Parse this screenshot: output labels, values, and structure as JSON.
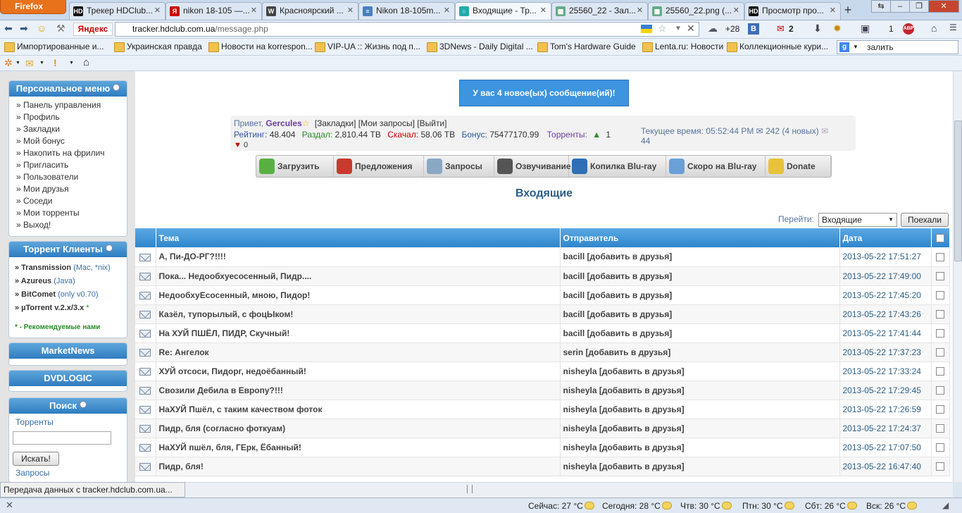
{
  "browser": {
    "menu_label": "Firefox",
    "tabs": [
      {
        "title": "Трекер HDClub...",
        "icon": "hd-icon"
      },
      {
        "title": "nikon 18-105 —...",
        "icon": "yandex-icon"
      },
      {
        "title": "Красноярский ...",
        "icon": "wikipedia-icon"
      },
      {
        "title": "Nikon 18-105m...",
        "icon": "page-icon"
      },
      {
        "title": "Входящие - Тр...",
        "icon": "loading-icon"
      },
      {
        "title": "25560_22 - Зал...",
        "icon": "image-icon"
      },
      {
        "title": "25560_22.png (...",
        "icon": "image-icon"
      },
      {
        "title": "Просмотр про...",
        "icon": "hd-icon"
      }
    ],
    "active_tab": 4,
    "new_tab_label": "+",
    "yandex_label": "Яндекс",
    "url_host": "tracker.hdclub.com.ua",
    "url_path": "/message.php",
    "weather_badge": "+28",
    "mail_count": "2",
    "counter_1": "1",
    "bookmarks": [
      "Импортированные и...",
      "Украинская правда",
      "Новости на korrespon...",
      "VIP-UA :: Жизнь под п...",
      "3DNews - Daily Digital ...",
      "Tom's Hardware Guide",
      "Lenta.ru: Новости",
      "Коллекционные кури..."
    ],
    "search_value": "залить",
    "status_text": "Передача данных с tracker.hdclub.com.ua...",
    "weather": [
      "Сейчас: 27 °C",
      "Сегодня: 28 °C",
      "Чтв: 30 °C",
      "Птн: 30 °C",
      "Сбт: 26 °C",
      "Вск: 26 °C"
    ]
  },
  "sidebar": {
    "personal_title": "Персональное меню",
    "personal_items": [
      "» Панель управления",
      "» Профиль",
      "» Закладки",
      "» Мой бонус",
      "» Накопить на фрилич",
      "» Пригласить",
      "» Пользователи",
      "» Мои друзья",
      "» Соседи",
      "» Мои торренты",
      "» Выход!"
    ],
    "clients_title": "Торрент Клиенты",
    "clients": [
      {
        "name": "» Transmission",
        "note": " (Mac, *nix)"
      },
      {
        "name": "» Azureus",
        "note": " (Java)"
      },
      {
        "name": "» BitComet",
        "note": " (only v0.70)"
      },
      {
        "name": "» µTorrent v.2.x/3.x",
        "note": " *"
      }
    ],
    "recommended_star": "*",
    "recommended_text": " - Рекомендуемые нами",
    "marketnews_title": "MarketNews",
    "dvdlogic_title": "DVDLOGIC",
    "search_title": "Поиск",
    "search_link": "Торренты",
    "search_button": "Искать!",
    "requests_link": "Запросы"
  },
  "main": {
    "new_messages": "У вас 4 новое(ых) сообщение(ий)!",
    "greeting": "Привет, ",
    "username": "Gercules",
    "user_links": "[Закладки] [Мои запросы] [Выйти]",
    "rating_label": "Рейтинг: ",
    "rating": "48.404",
    "upload_label": "Раздал: ",
    "upload": "2,810.44 TB",
    "download_label": "Скачал: ",
    "download": "58.06 TB",
    "bonus_label": "Бонус: ",
    "bonus": "75477170.99",
    "torrents_label": "Торренты: ",
    "seeding": "1",
    "leeching": "0",
    "time_label": "Текущее время: ",
    "time": "05:52:44 PM",
    "inbox_count": "242 (4 новых)",
    "outbox_count": "44",
    "actions": [
      {
        "label": "Загрузить",
        "color": "#58b043"
      },
      {
        "label": "Предложения",
        "color": "#c83a2e"
      },
      {
        "label": "Запросы",
        "color": "#8aa7c4"
      },
      {
        "label": "Озвучивание",
        "color": "#555555"
      },
      {
        "label": "Копилка Blu-ray",
        "color": "#2e6fb5"
      },
      {
        "label": "Скоро на Blu-ray",
        "color": "#6aa0d8"
      },
      {
        "label": "Donate",
        "color": "#e8c23a"
      }
    ],
    "page_title": "Входящие",
    "goto_label": "Перейти:",
    "goto_value": "Входящие",
    "goto_button": "Поехали",
    "columns": [
      "Тема",
      "Отправитель",
      "Дата"
    ],
    "messages": [
      {
        "subject": "А, Пи-ДО-РГ?!!!!",
        "sender": "bacill [добавить в друзья]",
        "date": "2013-05-22 17:51:27"
      },
      {
        "subject": "Пока... Недообхуесосенный, Пидр....",
        "sender": "bacill [добавить в друзья]",
        "date": "2013-05-22 17:49:00"
      },
      {
        "subject": "НедообхуЕсосенный, мною, Пидор!",
        "sender": "bacill [добавить в друзья]",
        "date": "2013-05-22 17:45:20"
      },
      {
        "subject": "Казёл, тупорылый, с фоцЫком!",
        "sender": "bacill [добавить в друзья]",
        "date": "2013-05-22 17:43:26"
      },
      {
        "subject": "На ХУЙ ПШЁЛ, ПИДР, Скучный!",
        "sender": "bacill [добавить в друзья]",
        "date": "2013-05-22 17:41:44"
      },
      {
        "subject": "Re: Ангелок",
        "sender": "serin [добавить в друзья]",
        "date": "2013-05-22 17:37:23"
      },
      {
        "subject": "ХУЙ отсоси, Пидорг, недоёбанный!",
        "sender": "nisheyla [добавить в друзья]",
        "date": "2013-05-22 17:33:24"
      },
      {
        "subject": "Свозили Дебила в Европу?!!!",
        "sender": "nisheyla [добавить в друзья]",
        "date": "2013-05-22 17:29:45"
      },
      {
        "subject": "НаХУЙ Пшёл, с таким качеством фоток",
        "sender": "nisheyla [добавить в друзья]",
        "date": "2013-05-22 17:26:59"
      },
      {
        "subject": "Пидр, бля (согласно фоткуам)",
        "sender": "nisheyla [добавить в друзья]",
        "date": "2013-05-22 17:24:37"
      },
      {
        "subject": "НаХУЙ пшёл, бля, ГЕрк, Ёбанный!",
        "sender": "nisheyla [добавить в друзья]",
        "date": "2013-05-22 17:07:50"
      },
      {
        "subject": "Пидр, бля!",
        "sender": "nisheyla [добавить в друзья]",
        "date": "2013-05-22 16:47:40"
      }
    ]
  }
}
